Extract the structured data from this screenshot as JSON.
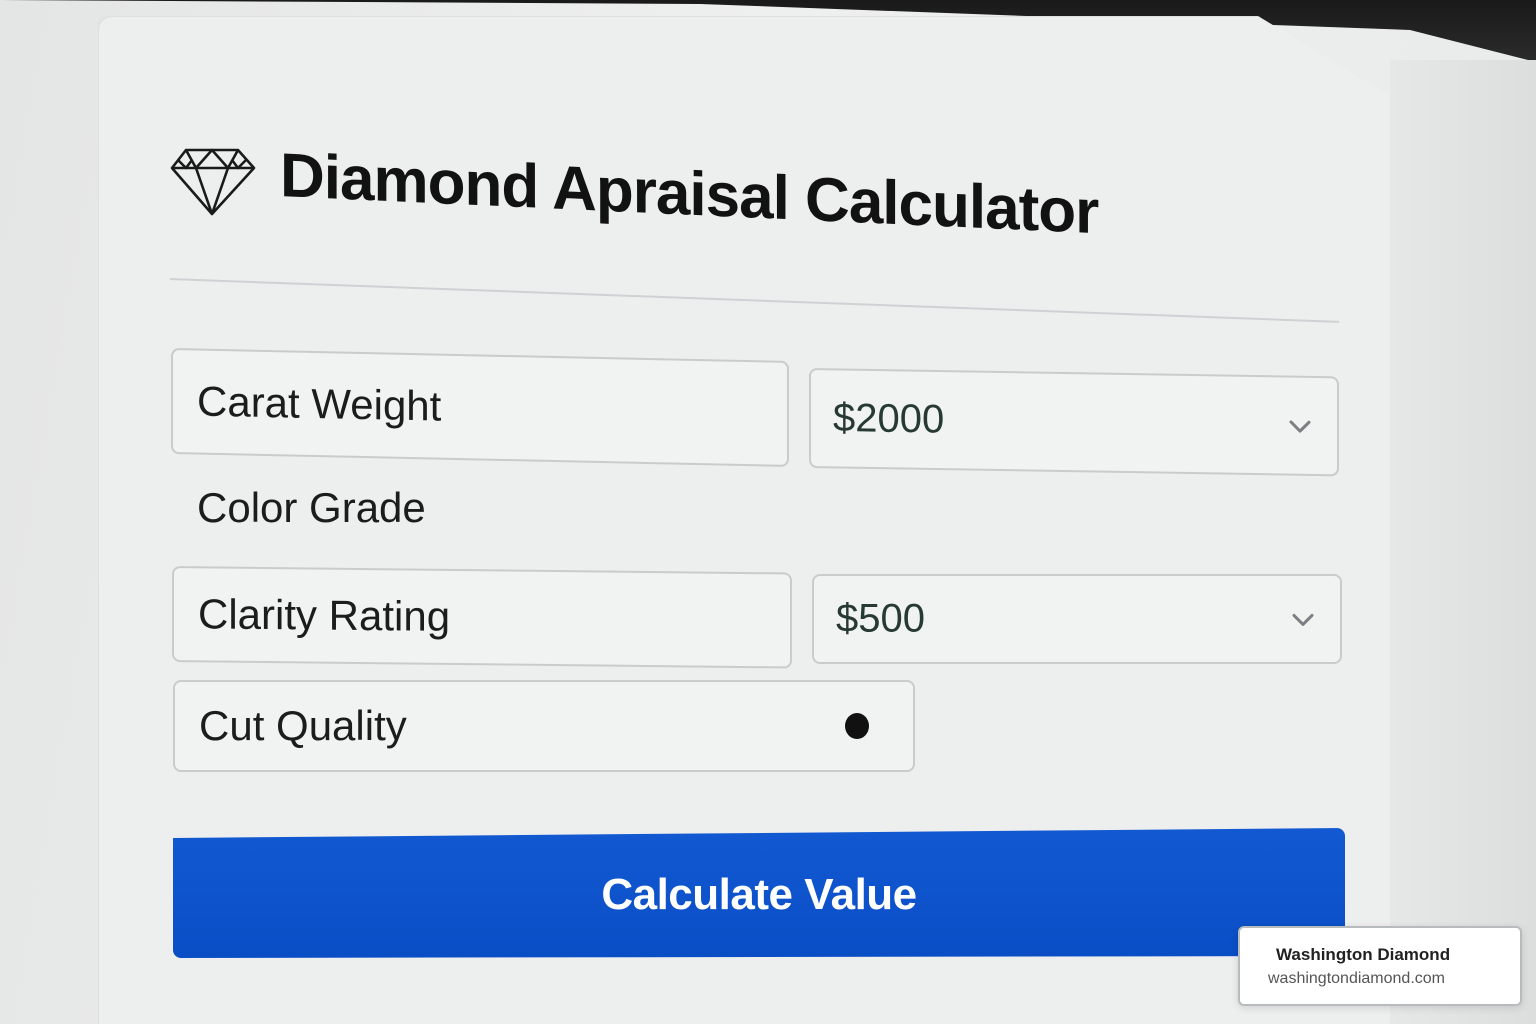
{
  "header": {
    "title": "Diamond Apraisal Calculator",
    "icon": "diamond-icon"
  },
  "form": {
    "carat_weight": {
      "label": "Carat Weight",
      "select_value": "$2000"
    },
    "color_grade": {
      "label": "Color Grade"
    },
    "clarity_rating": {
      "label": "Clarity Rating",
      "select_value": "$500"
    },
    "cut_quality": {
      "label": "Cut Quality"
    },
    "submit_label": "Calculate Value"
  },
  "badge": {
    "name": "Washington Diamond",
    "url": "washingtondiamond.com"
  },
  "colors": {
    "primary_button": "#0a4ec6",
    "card_background": "#edeeee",
    "field_border": "#c9cccd"
  }
}
